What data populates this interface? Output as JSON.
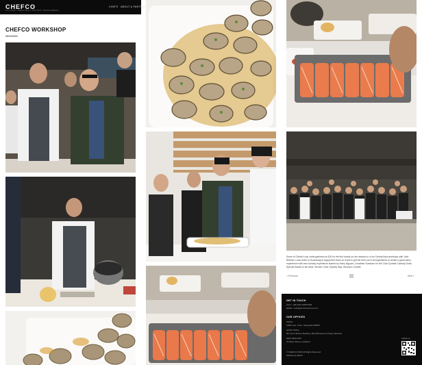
{
  "brand": {
    "logo": "CHEFCO",
    "tagline": "CULINARY SERVICES & PROJECT MANAGEMENT"
  },
  "nav": {
    "links": [
      "CHEFS",
      "ABOUT & PARTNER"
    ]
  },
  "post": {
    "title": "CHEFCO WORKSHOP",
    "date": "06/10/2018",
    "description": "Some of Chefco's top chefs gathered at 428 for the first hands-on live session in a fun Central Asia workshop with Josh Bittman, Lead chefs of Guandong to tapped the team on sushi to get the best out of all ingredients to create a great menu experience with new culinary experience shared by Harry Nguyen, Jonathan Sundram for the Club Gymbal Culinary Guild. Special thanks to all chefs, Kitchen Crew, Sydney Bay, Glenda & Charlie."
  },
  "pager": {
    "prev": "< Previous",
    "next": "Next >"
  },
  "footer": {
    "contact_heading": "GET IN TOUCH",
    "phone": "CALL: +86 (0)21 6258 0000",
    "email": "EMAIL: hello@chefcoservices.com",
    "offices_heading": "OUR OFFICES",
    "office_lines": [
      "CHINA",
      "1288 Lane, Puxin, Shanghai 200000",
      "HONG KONG",
      "8/F, First Harbour Building, 405-408 Harcourt Road, Wanchai",
      "NEW ZEALAND",
      "15 Albert Street, Auckland"
    ],
    "copyright": "© CHEFCO 2018 All Rights Reserved",
    "credit": "Website by ZECO",
    "follow_label": "Follow us"
  }
}
